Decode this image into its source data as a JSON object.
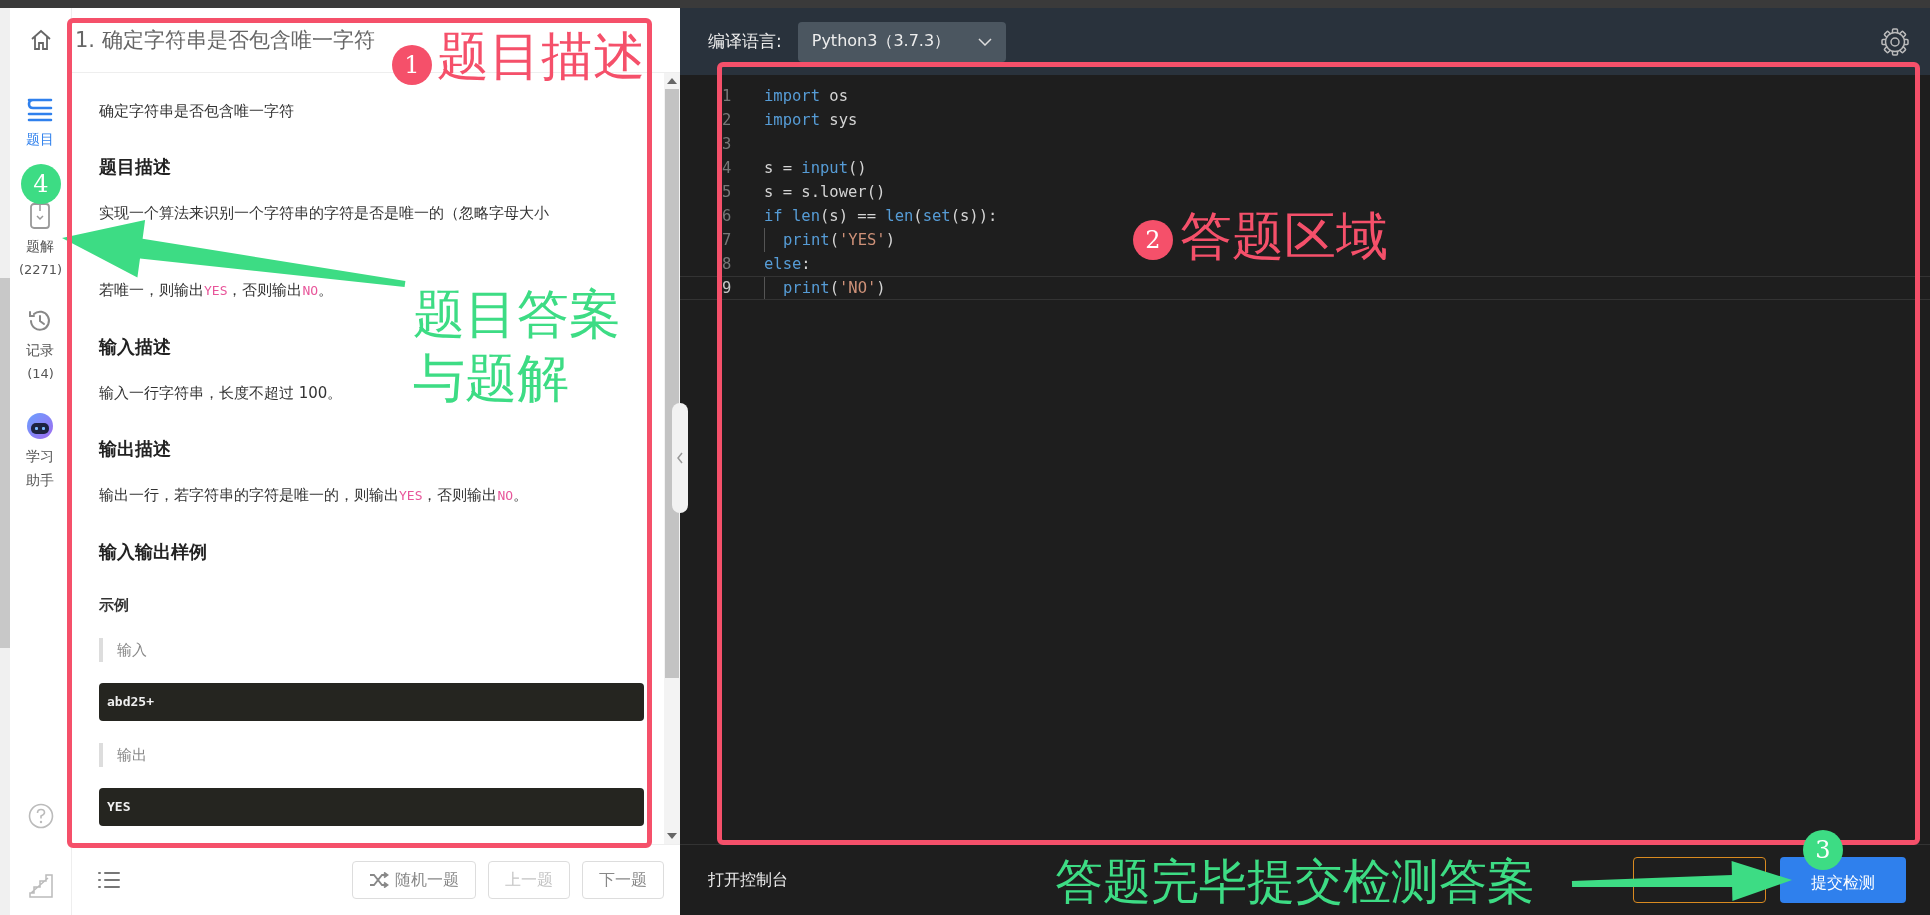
{
  "sidebar": {
    "items": [
      {
        "label": "题目",
        "kind": "list",
        "selected": true
      },
      {
        "label": "题解",
        "count": "(2271)",
        "kind": "solution",
        "selected": false
      },
      {
        "label": "记录",
        "count": "(14)",
        "kind": "history",
        "selected": false
      },
      {
        "label": "学习助手",
        "kind": "robot",
        "selected": false
      }
    ]
  },
  "problem": {
    "title": "1. 确定字符串是否包含唯一字符",
    "blocks": [
      {
        "kind": "paragraph",
        "text": "确定字符串是否包含唯一字符"
      },
      {
        "kind": "heading",
        "text": "题目描述"
      },
      {
        "kind": "paragraph",
        "text": "实现一个算法来识别一个字符串的字符是否是唯一的（忽略字母大小"
      },
      {
        "kind": "paragraph",
        "parts": [
          {
            "text": "若唯一，则输出",
            "kind": "text"
          },
          {
            "text": "YES",
            "kind": "code"
          },
          {
            "text": "，否则输出",
            "kind": "text"
          },
          {
            "text": "NO",
            "kind": "code"
          },
          {
            "text": "。",
            "kind": "text"
          }
        ]
      },
      {
        "kind": "heading",
        "text": "输入描述"
      },
      {
        "kind": "paragraph",
        "text": "输入一行字符串，长度不超过 100。"
      },
      {
        "kind": "heading",
        "text": "输出描述"
      },
      {
        "kind": "paragraph",
        "parts": [
          {
            "text": "输出一行，若字符串的字符是唯一的，则输出",
            "kind": "text"
          },
          {
            "text": "YES",
            "kind": "code"
          },
          {
            "text": "，否则输出",
            "kind": "text"
          },
          {
            "text": "NO",
            "kind": "code"
          },
          {
            "text": "。",
            "kind": "text"
          }
        ]
      },
      {
        "kind": "heading",
        "text": "输入输出样例"
      },
      {
        "kind": "subheading",
        "text": "示例"
      },
      {
        "kind": "quote",
        "text": "输入"
      },
      {
        "kind": "code",
        "text": "abd25+"
      },
      {
        "kind": "quote",
        "text": "输出"
      },
      {
        "kind": "code",
        "text": "YES"
      }
    ],
    "buttons": [
      {
        "label": "随机一题",
        "kind": "shuffle",
        "disabled": false
      },
      {
        "label": "上一题",
        "kind": "plain",
        "disabled": true
      },
      {
        "label": "下一题",
        "kind": "plain",
        "disabled": false
      }
    ]
  },
  "editor": {
    "language_label": "编译语言:",
    "language": "Python3（3.7.3）",
    "lines": [
      {
        "number": "1",
        "indent": false,
        "current": false,
        "tokens": [
          {
            "text": "import",
            "kind": "keyword"
          },
          {
            "text": " os",
            "kind": "plain"
          }
        ]
      },
      {
        "number": "2",
        "indent": false,
        "current": false,
        "tokens": [
          {
            "text": "import",
            "kind": "keyword"
          },
          {
            "text": " sys",
            "kind": "plain"
          }
        ]
      },
      {
        "number": "3",
        "indent": false,
        "current": false
      },
      {
        "number": "4",
        "indent": false,
        "current": false,
        "tokens": [
          {
            "text": "s = ",
            "kind": "plain"
          },
          {
            "text": "input",
            "kind": "keyword"
          },
          {
            "text": "()",
            "kind": "plain"
          }
        ]
      },
      {
        "number": "5",
        "indent": false,
        "current": false,
        "tokens": [
          {
            "text": "s = s.lower()",
            "kind": "plain"
          }
        ]
      },
      {
        "number": "6",
        "indent": false,
        "current": false,
        "tokens": [
          {
            "text": "if len",
            "kind": "keyword"
          },
          {
            "text": "(s) == ",
            "kind": "plain"
          },
          {
            "text": "len",
            "kind": "keyword"
          },
          {
            "text": "(",
            "kind": "plain"
          },
          {
            "text": "set",
            "kind": "keyword"
          },
          {
            "text": "(s)):",
            "kind": "plain"
          }
        ]
      },
      {
        "number": "7",
        "indent": true,
        "current": false,
        "tokens": [
          {
            "text": "print",
            "kind": "keyword"
          },
          {
            "text": "(",
            "kind": "plain"
          },
          {
            "text": "'YES'",
            "kind": "string"
          },
          {
            "text": ")",
            "kind": "plain"
          }
        ]
      },
      {
        "number": "8",
        "indent": false,
        "current": false,
        "tokens": [
          {
            "text": "else",
            "kind": "keyword"
          },
          {
            "text": ":",
            "kind": "plain"
          }
        ]
      },
      {
        "number": "9",
        "indent": true,
        "current": true,
        "tokens": [
          {
            "text": "print",
            "kind": "keyword"
          },
          {
            "text": "(",
            "kind": "plain"
          },
          {
            "text": "'NO'",
            "kind": "string"
          },
          {
            "text": ")",
            "kind": "plain"
          }
        ]
      }
    ],
    "console_label": "打开控制台",
    "buttons": [
      {
        "kind": "outline"
      },
      {
        "kind": "primary",
        "label": "提交检测"
      }
    ]
  },
  "annotations": [
    {
      "kind": "frame",
      "badge": "1",
      "caption_lines": [
        "题目描述"
      ],
      "color": "#f5506a"
    },
    {
      "kind": "frame",
      "badge": "2",
      "caption_lines": [
        "答题区域"
      ],
      "color": "#f5506a"
    },
    {
      "kind": "arrow",
      "badge": "4",
      "caption_lines": [
        "题目答案",
        "与题解"
      ],
      "color": "#3ddc84"
    },
    {
      "kind": "arrow",
      "badge": "3",
      "caption_lines": [
        "答题完毕提交检测答案"
      ],
      "color": "#3ddc84"
    }
  ]
}
